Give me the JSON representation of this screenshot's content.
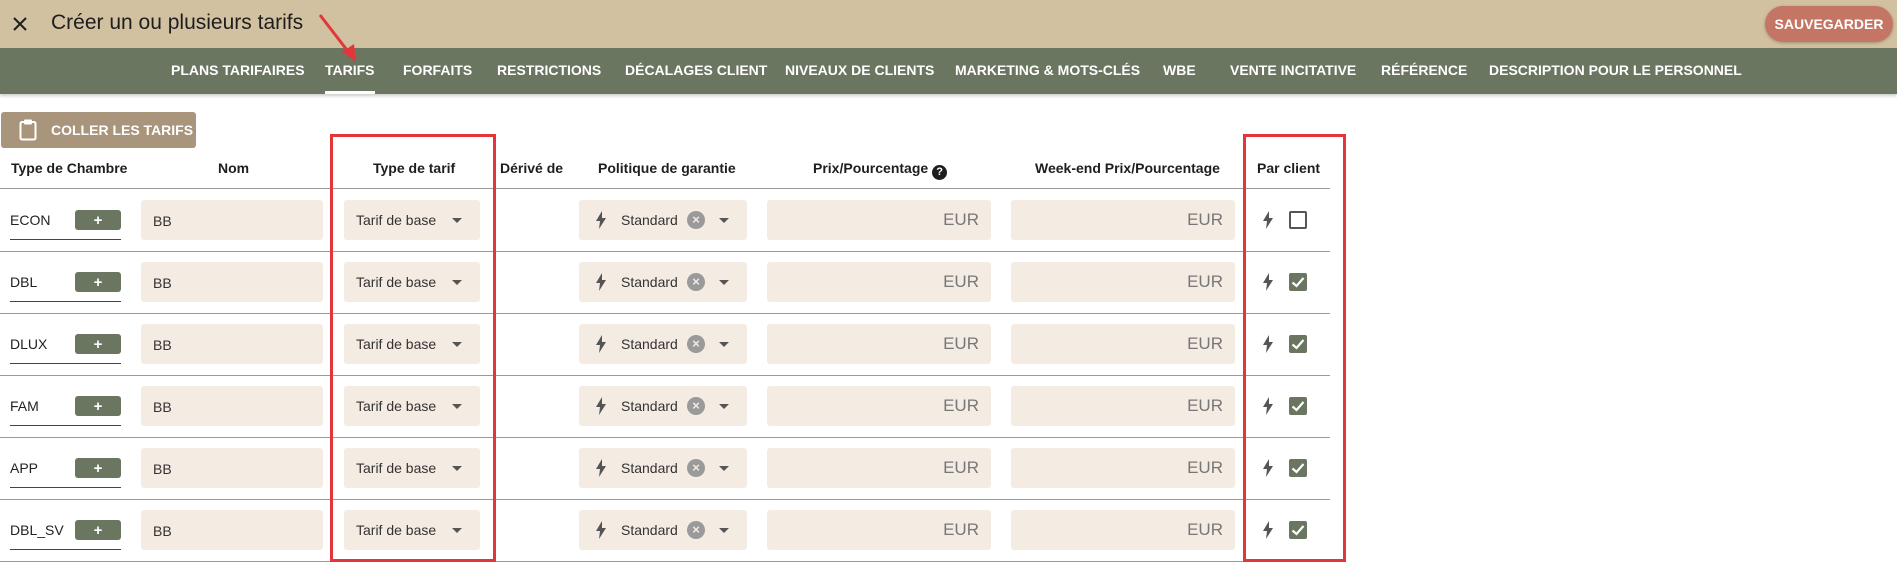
{
  "header": {
    "title": "Créer un ou plusieurs tarifs",
    "save_label": "SAUVEGARDER",
    "close_icon": "close-icon"
  },
  "tabs": [
    {
      "label": "PLANS TARIFAIRES",
      "active": false
    },
    {
      "label": "TARIFS",
      "active": true
    },
    {
      "label": "FORFAITS",
      "active": false
    },
    {
      "label": "RESTRICTIONS",
      "active": false
    },
    {
      "label": "DÉCALAGES CLIENT",
      "active": false
    },
    {
      "label": "NIVEAUX DE CLIENTS",
      "active": false
    },
    {
      "label": "MARKETING & MOTS-CLÉS",
      "active": false
    },
    {
      "label": "WBE",
      "active": false
    },
    {
      "label": "VENTE INCITATIVE",
      "active": false
    },
    {
      "label": "RÉFÉRENCE",
      "active": false
    },
    {
      "label": "DESCRIPTION POUR LE PERSONNEL",
      "active": false
    }
  ],
  "toolbar": {
    "paste_label": "COLLER LES TARIFS",
    "paste_icon": "clipboard-icon"
  },
  "table": {
    "columns": {
      "room_type": "Type de Chambre",
      "name": "Nom",
      "rate_type": "Type de tarif",
      "derived_from": "Dérivé de",
      "guarantee_policy": "Politique de garantie",
      "price": "Prix/Pourcentage",
      "weekend_price": "Week-end Prix/Pourcentage",
      "per_client": "Par client"
    },
    "add_label": "+",
    "rows": [
      {
        "room": "ECON",
        "name": "BB",
        "rate_type": "Tarif de base",
        "policy": "Standard",
        "price": "EUR",
        "weekend_price": "EUR",
        "per_client": false
      },
      {
        "room": "DBL",
        "name": "BB",
        "rate_type": "Tarif de base",
        "policy": "Standard",
        "price": "EUR",
        "weekend_price": "EUR",
        "per_client": true
      },
      {
        "room": "DLUX",
        "name": "BB",
        "rate_type": "Tarif de base",
        "policy": "Standard",
        "price": "EUR",
        "weekend_price": "EUR",
        "per_client": true
      },
      {
        "room": "FAM",
        "name": "BB",
        "rate_type": "Tarif de base",
        "policy": "Standard",
        "price": "EUR",
        "weekend_price": "EUR",
        "per_client": true
      },
      {
        "room": "APP",
        "name": "BB",
        "rate_type": "Tarif de base",
        "policy": "Standard",
        "price": "EUR",
        "weekend_price": "EUR",
        "per_client": true
      },
      {
        "room": "DBL_SV",
        "name": "BB",
        "rate_type": "Tarif de base",
        "policy": "Standard",
        "price": "EUR",
        "weekend_price": "EUR",
        "per_client": true
      }
    ]
  },
  "colors": {
    "header_bg": "#d1c1a0",
    "tabbar_bg": "#6a7660",
    "save_bg": "#c47564",
    "paste_bg": "#a9957b",
    "field_bg": "#f4ebe3",
    "highlight": "#e3363a"
  }
}
